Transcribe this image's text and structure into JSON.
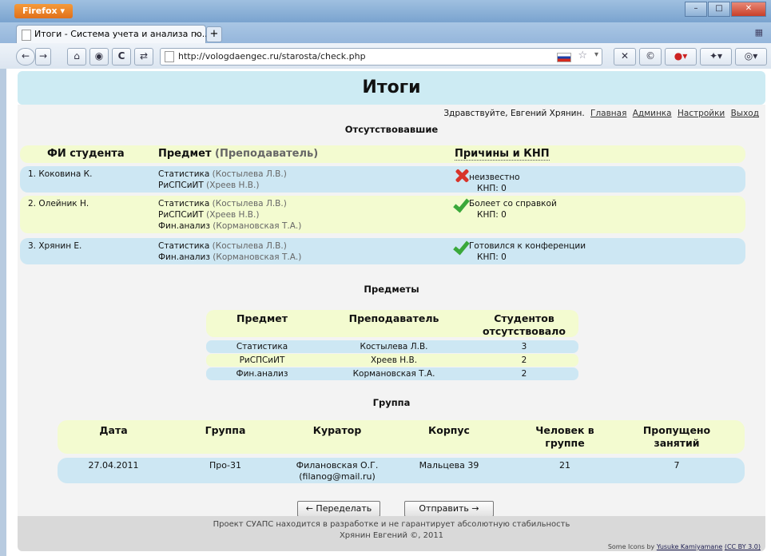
{
  "browser": {
    "app_button": "Firefox ▾",
    "window_buttons": {
      "minimize": "–",
      "maximize": "□",
      "close": "✕"
    },
    "tab_title": "Итоги - Система учета и анализа по...",
    "tab_close": "×",
    "new_tab": "+",
    "url": "http://vologdaengec.ru/starosta/check.php",
    "nav_buttons": {
      "back": "←",
      "forward": "→",
      "home": "⌂",
      "reload": "C"
    }
  },
  "page": {
    "title": "Итоги",
    "greeting": "Здравствуйте, Евгений Хрянин.",
    "nav_links": [
      "Главная",
      "Админка",
      "Настройки",
      "Выход"
    ]
  },
  "absent": {
    "section_title": "Отсутствовавшие",
    "headers": {
      "student": "ФИ студента",
      "subject": "Предмет",
      "teacher": "(Преподаватель)",
      "reasons": "Причины и КНП"
    },
    "rows": [
      {
        "student": "1. Коковина К.",
        "subjects": [
          {
            "subject": "Статистика",
            "teacher": "(Костылева Л.В.)"
          },
          {
            "subject": "РиСПСиИТ",
            "teacher": "(Хреев Н.В.)"
          }
        ],
        "status": "x",
        "reason": "неизвестно",
        "knp": "КНП: 0"
      },
      {
        "student": "2. Олейник Н.",
        "subjects": [
          {
            "subject": "Статистика",
            "teacher": "(Костылева Л.В.)"
          },
          {
            "subject": "РиСПСиИТ",
            "teacher": "(Хреев Н.В.)"
          },
          {
            "subject": "Фин.анализ",
            "teacher": "(Кормановская Т.А.)"
          }
        ],
        "status": "ok",
        "reason": "Болеет со справкой",
        "knp": "КНП: 0"
      },
      {
        "student": "3. Хрянин Е.",
        "subjects": [
          {
            "subject": "Статистика",
            "teacher": "(Костылева Л.В.)"
          },
          {
            "subject": "Фин.анализ",
            "teacher": "(Кормановская Т.А.)"
          }
        ],
        "status": "ok",
        "reason": "Готовился к конференции",
        "knp": "КНП: 0"
      }
    ]
  },
  "subjects": {
    "section_title": "Предметы",
    "headers": {
      "subject": "Предмет",
      "teacher": "Преподаватель",
      "count_line1": "Студентов",
      "count_line2": "отсутствовало"
    },
    "rows": [
      {
        "subject": "Статистика",
        "teacher": "Костылева Л.В.",
        "count": "3"
      },
      {
        "subject": "РиСПСиИТ",
        "teacher": "Хреев Н.В.",
        "count": "2"
      },
      {
        "subject": "Фин.анализ",
        "teacher": "Кормановская Т.А.",
        "count": "2"
      }
    ]
  },
  "group": {
    "section_title": "Группа",
    "headers": {
      "date": "Дата",
      "group": "Группа",
      "curator": "Куратор",
      "building": "Корпус",
      "people_line1": "Человек в",
      "people_line2": "группе",
      "missed_line1": "Пропущено",
      "missed_line2": "занятий"
    },
    "row": {
      "date": "27.04.2011",
      "group": "Про-31",
      "curator_line1": "Филановская О.Г.",
      "curator_line2": "(filanog@mail.ru)",
      "building": "Мальцева 39",
      "people": "21",
      "missed": "7"
    }
  },
  "actions": {
    "redo": "← Переделать",
    "send": "Отправить →"
  },
  "footer": {
    "line1": "Проект СУАПС находится в разработке и не гарантирует абсолютную стабильность",
    "line2": "Хрянин Евгений ©, 2011",
    "credit_prefix": "Some Icons by",
    "credit_author": "Yusuke Kamiyamane",
    "credit_license": "(CC BY 3.0)"
  }
}
